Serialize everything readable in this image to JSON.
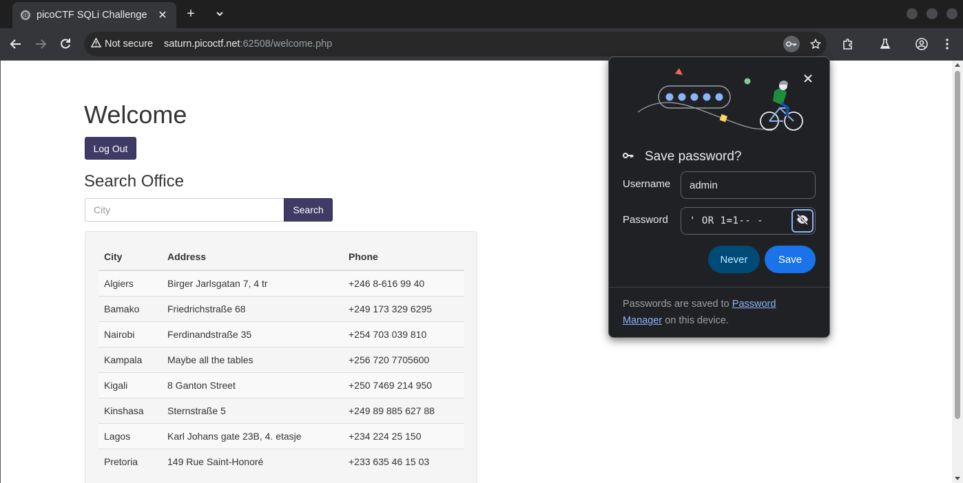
{
  "browser": {
    "tab_title": "picoCTF SQLi Challenge",
    "security_label": "Not secure",
    "url_host": "saturn.picoctf.net",
    "url_rest": ":62508/welcome.php"
  },
  "page": {
    "heading": "Welcome",
    "logout_label": "Log Out",
    "search_heading": "Search Office",
    "city_placeholder": "City",
    "search_label": "Search",
    "table": {
      "headers": [
        "City",
        "Address",
        "Phone"
      ],
      "rows": [
        [
          "Algiers",
          "Birger Jarlsgatan 7, 4 tr",
          "+246 8-616 99 40"
        ],
        [
          "Bamako",
          "Friedrichstraße 68",
          "+249 173 329 6295"
        ],
        [
          "Nairobi",
          "Ferdinandstraße 35",
          "+254 703 039 810"
        ],
        [
          "Kampala",
          "Maybe all the tables",
          "+256 720 7705600"
        ],
        [
          "Kigali",
          "8 Ganton Street",
          "+250 7469 214 950"
        ],
        [
          "Kinshasa",
          "Sternstraße 5",
          "+249 89 885 627 88"
        ],
        [
          "Lagos",
          "Karl Johans gate 23B, 4. etasje",
          "+234 224 25 150"
        ],
        [
          "Pretoria",
          "149 Rue Saint-Honoré",
          "+233 635 46 15 03"
        ]
      ]
    }
  },
  "password_popup": {
    "title": "Save password?",
    "username_label": "Username",
    "username_value": "admin",
    "password_label": "Password",
    "password_value": "' OR 1=1-- -",
    "never_label": "Never",
    "save_label": "Save",
    "footer_before": "Passwords are saved to ",
    "footer_link": "Password Manager",
    "footer_after": " on this device."
  },
  "colors": {
    "primary_button": "#3f3a66",
    "popup_bg": "#202124",
    "save_button": "#1a73e8",
    "never_button": "#004a77"
  }
}
